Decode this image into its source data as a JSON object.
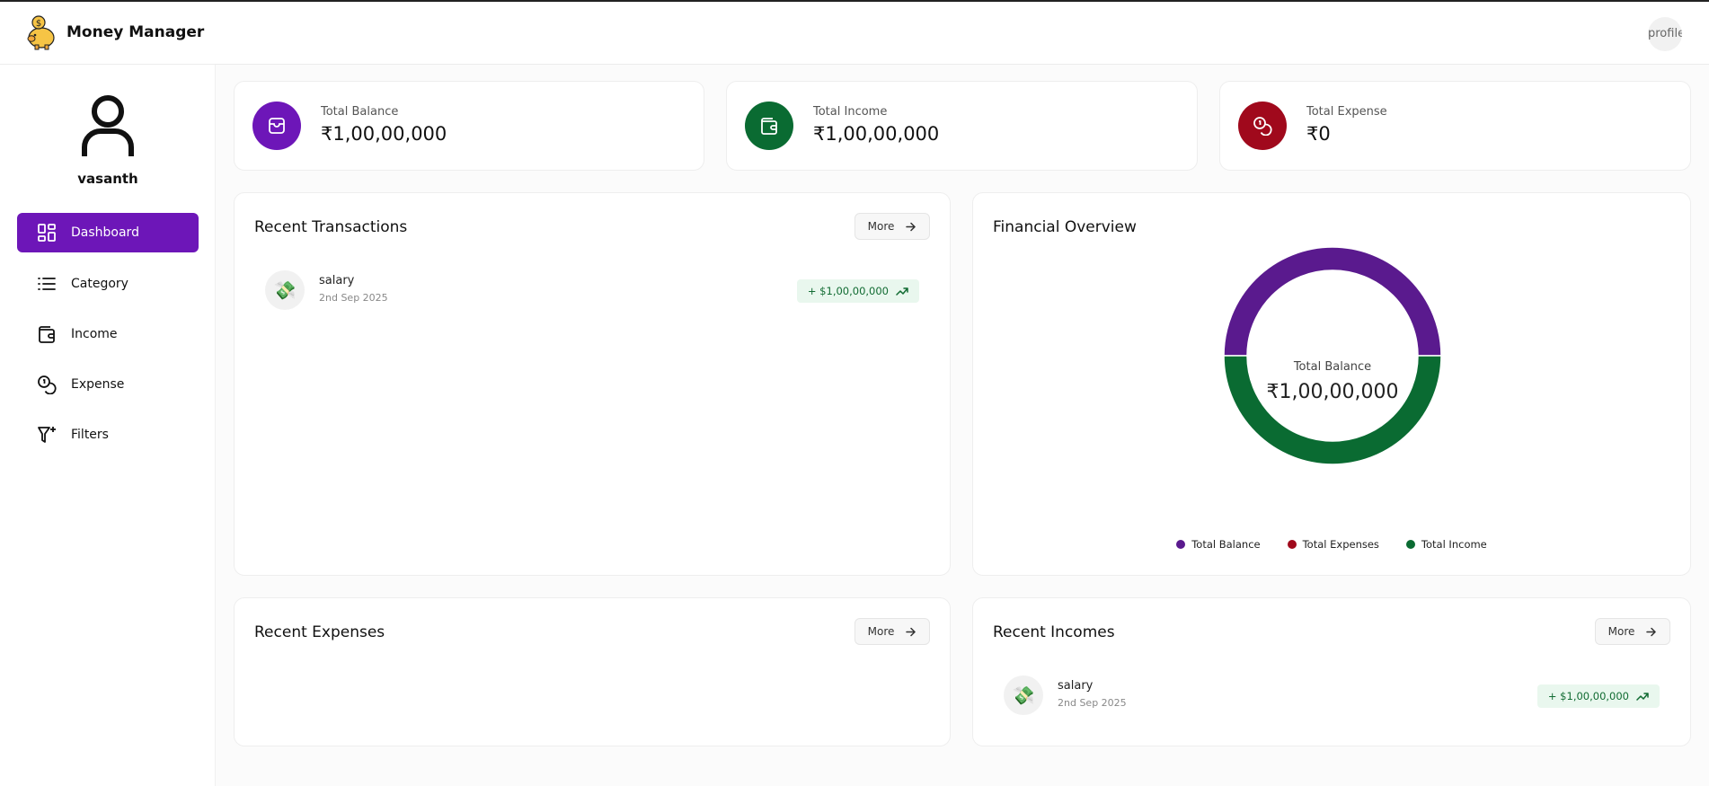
{
  "app": {
    "title": "Money Manager",
    "profile_alt": "profile"
  },
  "sidebar": {
    "username": "vasanth",
    "items": [
      {
        "label": "Dashboard",
        "icon": "dashboard-grid-icon",
        "active": true
      },
      {
        "label": "Category",
        "icon": "list-icon",
        "active": false
      },
      {
        "label": "Income",
        "icon": "wallet-icon",
        "active": false
      },
      {
        "label": "Expense",
        "icon": "coins-icon",
        "active": false
      },
      {
        "label": "Filters",
        "icon": "filter-plus-icon",
        "active": false
      }
    ]
  },
  "stats": [
    {
      "label": "Total Balance",
      "value": "₹1,00,00,000",
      "color": "#6d16b8",
      "icon": "card-icon"
    },
    {
      "label": "Total Income",
      "value": "₹1,00,00,000",
      "color": "#0a6b32",
      "icon": "wallet-icon"
    },
    {
      "label": "Total Expense",
      "value": "₹0",
      "color": "#a0091c",
      "icon": "coins-icon"
    }
  ],
  "recent_transactions": {
    "title": "Recent Transactions",
    "more_label": "More",
    "items": [
      {
        "name": "salary",
        "date": "2nd Sep 2025",
        "amount": "+ $1,00,00,000",
        "icon": "money-icon"
      }
    ]
  },
  "financial_overview": {
    "title": "Financial Overview",
    "center_label": "Total Balance",
    "center_value": "₹1,00,00,000",
    "legend": [
      {
        "label": "Total Balance",
        "color": "#5a1a8e"
      },
      {
        "label": "Total Expenses",
        "color": "#a0091c"
      },
      {
        "label": "Total Income",
        "color": "#0a6b32"
      }
    ]
  },
  "chart_data": {
    "type": "pie",
    "categories": [
      "Total Balance",
      "Total Expenses",
      "Total Income"
    ],
    "values": [
      10000000,
      0,
      10000000
    ],
    "colors": [
      "#5a1a8e",
      "#a0091c",
      "#0a6b32"
    ],
    "title": "Financial Overview",
    "legend": "bottom"
  },
  "recent_expenses": {
    "title": "Recent Expenses",
    "more_label": "More",
    "items": []
  },
  "recent_incomes": {
    "title": "Recent Incomes",
    "more_label": "More",
    "items": [
      {
        "name": "salary",
        "date": "2nd Sep 2025",
        "amount": "+ $1,00,00,000",
        "icon": "money-icon"
      }
    ]
  }
}
